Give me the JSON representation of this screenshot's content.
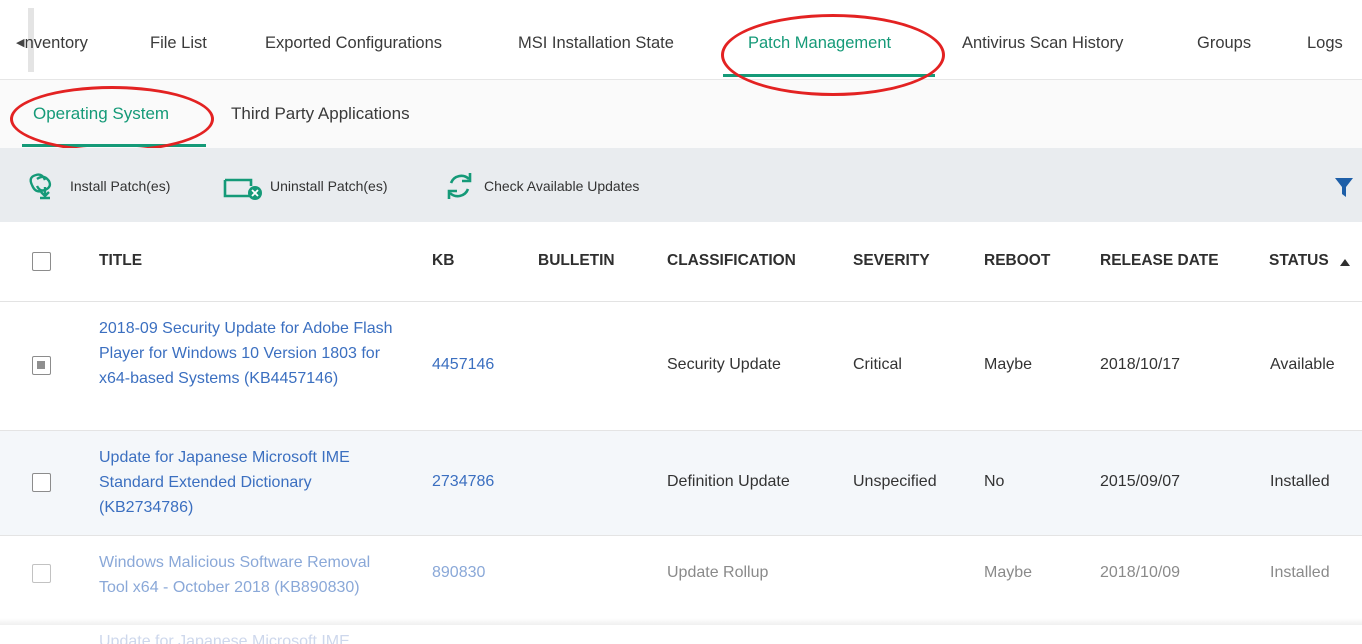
{
  "top_tabs": [
    {
      "label": "Inventory"
    },
    {
      "label": "File List"
    },
    {
      "label": "Exported Configurations"
    },
    {
      "label": "MSI Installation State"
    },
    {
      "label": "Patch Management"
    },
    {
      "label": "Antivirus Scan History"
    },
    {
      "label": "Groups"
    },
    {
      "label": "Logs"
    }
  ],
  "active_top_tab": "Patch Management",
  "sub_tabs": [
    {
      "label": "Operating System"
    },
    {
      "label": "Third Party Applications"
    }
  ],
  "active_sub_tab": "Operating System",
  "toolbar": {
    "install_label": "Install Patch(es)",
    "uninstall_label": "Uninstall Patch(es)",
    "check_label": "Check Available Updates"
  },
  "table": {
    "columns": [
      "TITLE",
      "KB",
      "BULLETIN",
      "CLASSIFICATION",
      "SEVERITY",
      "REBOOT",
      "RELEASE DATE",
      "STATUS"
    ],
    "sort": {
      "column": "STATUS",
      "direction": "ascending"
    },
    "rows": [
      {
        "checked": true,
        "title": "2018-09 Security Update for Adobe Flash Player for Windows 10 Version 1803 for x64-based Systems (KB4457146)",
        "kb": "4457146",
        "bulletin": "",
        "classification": "Security Update",
        "severity": "Critical",
        "reboot": "Maybe",
        "release_date": "2018/10/17",
        "status": "Available"
      },
      {
        "checked": false,
        "title": "Update for Japanese Microsoft IME Standard Extended Dictionary (KB2734786)",
        "kb": "2734786",
        "bulletin": "",
        "classification": "Definition Update",
        "severity": "Unspecified",
        "reboot": "No",
        "release_date": "2015/09/07",
        "status": "Installed"
      },
      {
        "checked": false,
        "title": "Windows Malicious Software Removal Tool x64 - October 2018 (KB890830)",
        "kb": "890830",
        "bulletin": "",
        "classification": "Update Rollup",
        "severity": "",
        "reboot": "Maybe",
        "release_date": "2018/10/09",
        "status": "Installed"
      }
    ],
    "partial_row_title": "Update for Japanese Microsoft IME"
  },
  "colors": {
    "accent": "#159a78",
    "link": "#3b6fc0",
    "annotation": "#e32222",
    "toolbar_bg": "#e9ecef",
    "filter_icon": "#1e5fa8"
  },
  "icons": [
    "scroll-left-icon",
    "install-patch-icon",
    "uninstall-patch-icon",
    "refresh-icon",
    "filter-icon",
    "sort-ascending-icon"
  ]
}
